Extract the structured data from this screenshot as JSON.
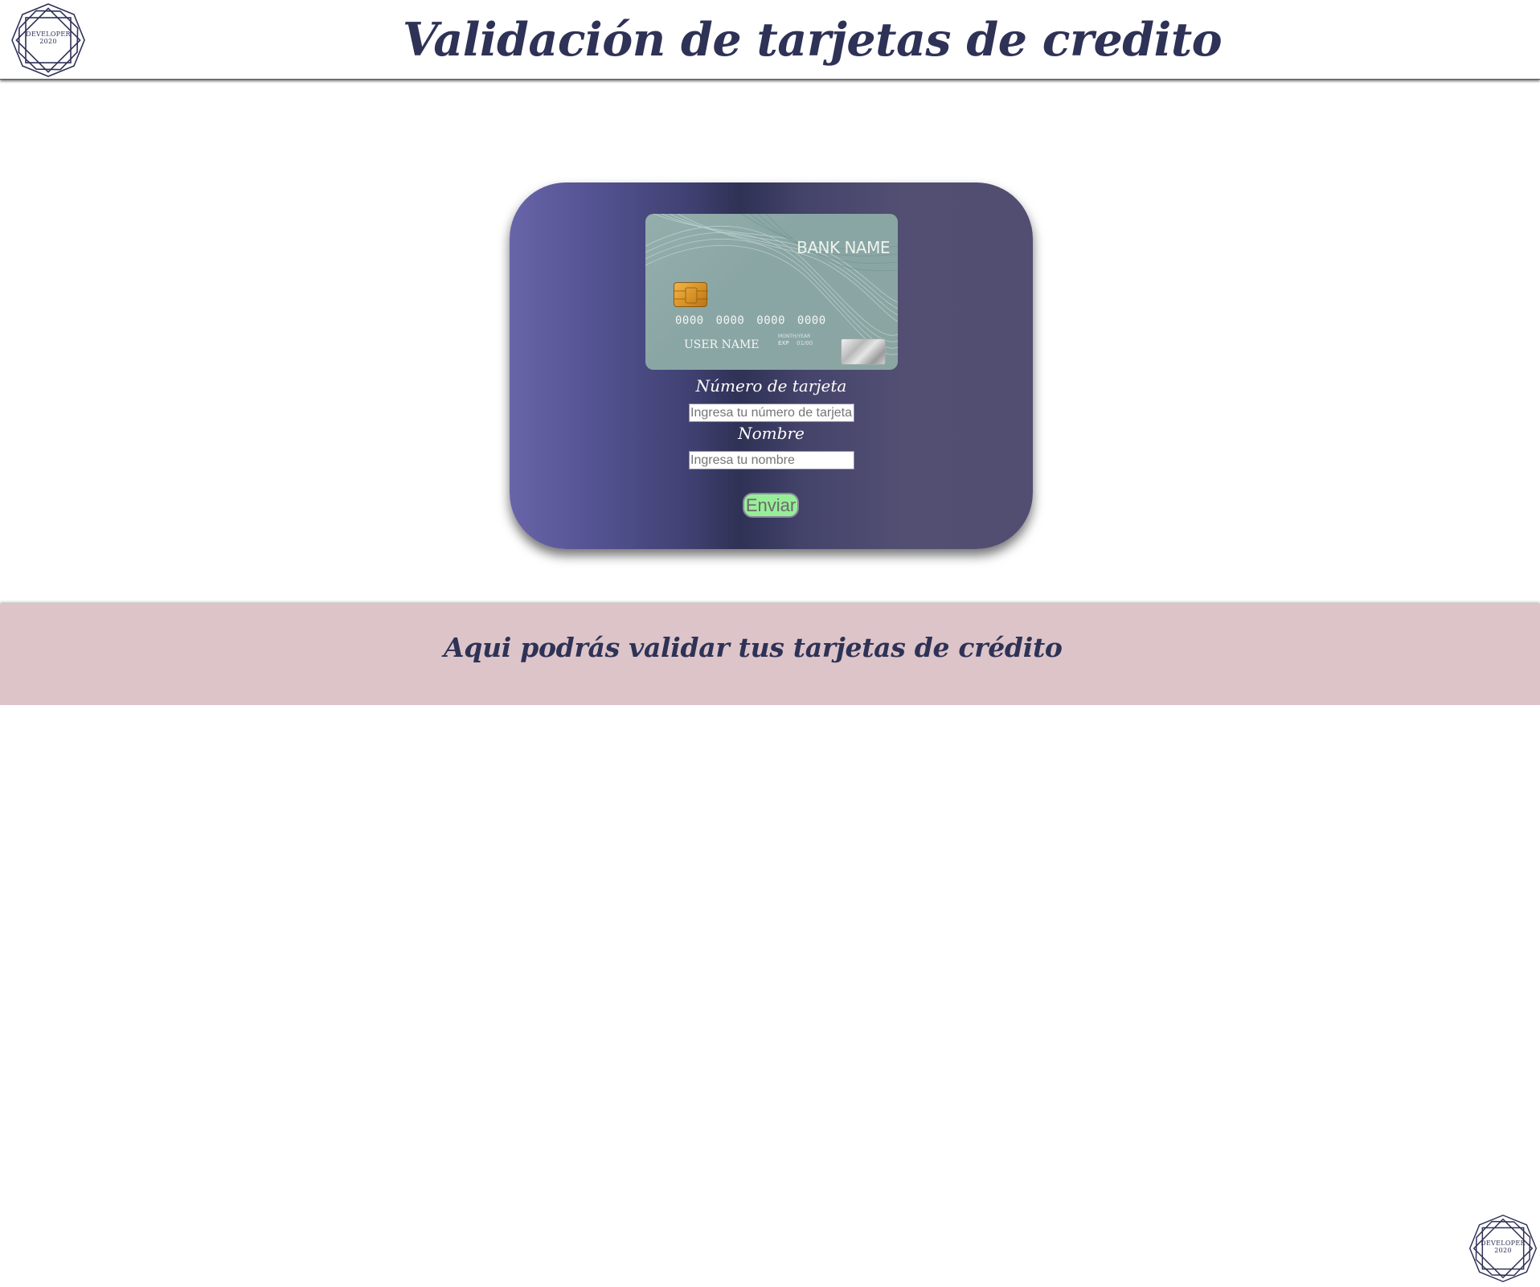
{
  "header": {
    "title": "Validación de tarjetas de credito",
    "logo": {
      "line1": "DEVELOPER",
      "line2": "2020",
      "icon": "octagon-star-logo"
    }
  },
  "card": {
    "bank_name": "BANK NAME",
    "number": "0000 0000 0000 0000",
    "holder": "USER NAME",
    "exp_small": "MONTH/YEAR",
    "exp_label": "EXP",
    "exp_date": "01/00"
  },
  "form": {
    "number_label": "Número de tarjeta",
    "number_placeholder": "Ingresa tu número de tarjeta",
    "name_label": "Nombre",
    "name_placeholder": "Ingresa tu nombre",
    "submit_label": "Enviar"
  },
  "footer": {
    "text": "Aqui podrás validar tus tarjetas de crédito",
    "logo": {
      "line1": "DEVELOPER",
      "line2": "2020",
      "icon": "octagon-star-logo"
    }
  },
  "colors": {
    "brand": "#2e3256",
    "footer_bg": "#dcc4c8",
    "button_bg": "#98ee98",
    "panel_left": "#6864a8",
    "panel_right": "#524e72"
  }
}
